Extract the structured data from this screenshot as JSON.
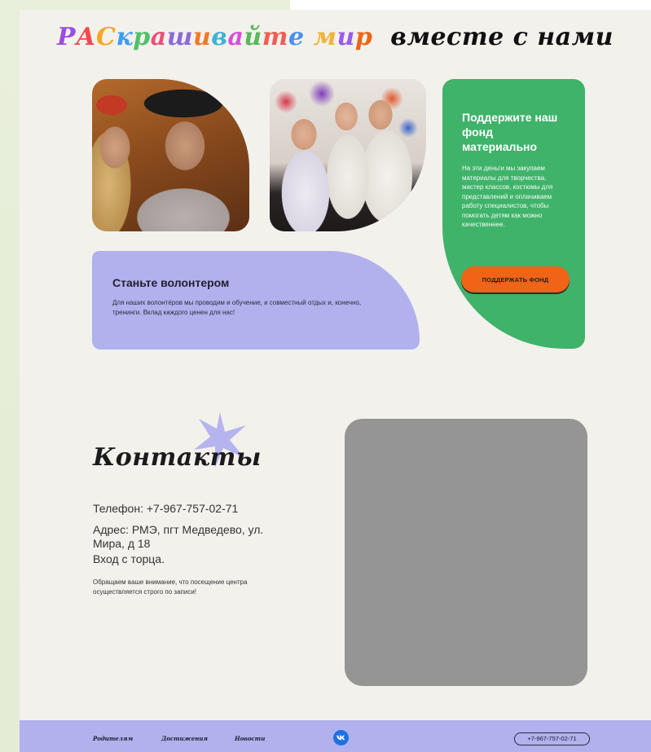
{
  "headline": {
    "colored_part": "РАСкрашивайте мир",
    "rest": "вместе с нами",
    "letter_colors": [
      "#9b4de0",
      "#f04a4a",
      "#f5a623",
      "#3f9cf2",
      "#4fbf6a",
      "#e8507a",
      "#8c6ad9",
      "#f07a2a",
      "#3fb3d6",
      "#d94fd9",
      "#59b85b",
      "#f25c54",
      "#4a8ff0",
      "#f0b43a",
      "#9a5ce8",
      "#ef6417",
      "#45b5a0"
    ]
  },
  "photos": {
    "photo1_alt": "volunteer photo 1",
    "photo2_alt": "volunteer photo 2"
  },
  "support": {
    "title": "Поддержите наш фонд материально",
    "text": "На эти деньги мы закупаем материалы для творчества, мастер классов, костюмы для представлений и оплачиваем работу специалистов, чтобы помогать детям как можно качественнее.",
    "button": "ПОДДЕРЖАТЬ ФОНД",
    "color": "#3fb36a",
    "button_color": "#ef6417"
  },
  "volunteer": {
    "title": "Станьте волонтером",
    "text": "Для наших волонтёров мы проводим и обучение, и совместный отдых и, конечно, тренинги. Вклад каждого ценен для нас!",
    "color": "#b1b1ee"
  },
  "contacts": {
    "title": "Контакты",
    "phone": "Телефон: +7-967-757-02-71",
    "address": "Адрес: РМЭ, пгт Медведево, ул. Мира, д 18",
    "entrance": "Вход с торца.",
    "note": "Обращаем ваше внимание, что посещение центра осуществляется строго по записи!"
  },
  "footer": {
    "links": [
      "Родителям",
      "Достижения",
      "Новости"
    ],
    "social": "vk-icon",
    "phone": "+7-967-757-02-71"
  }
}
